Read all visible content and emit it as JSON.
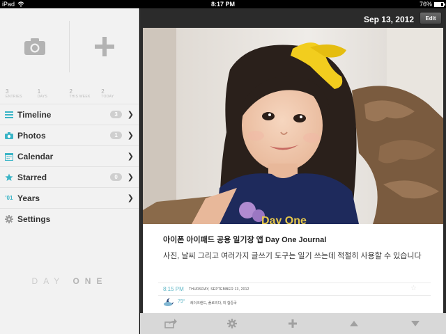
{
  "status": {
    "device": "iPad",
    "time": "8:17 PM",
    "battery": "76%",
    "battery_fraction": 0.76
  },
  "stats": [
    {
      "value": "3",
      "label": "ENTRIES"
    },
    {
      "value": "1",
      "label": "DAYS"
    },
    {
      "value": "2",
      "label": "THIS WEEK"
    },
    {
      "value": "2",
      "label": "TODAY"
    }
  ],
  "nav": [
    {
      "label": "Timeline",
      "badge": "3",
      "icon": "list-icon"
    },
    {
      "label": "Photos",
      "badge": "1",
      "icon": "camera-icon"
    },
    {
      "label": "Calendar",
      "badge": "",
      "icon": "calendar-icon"
    },
    {
      "label": "Starred",
      "badge": "0",
      "icon": "star-icon"
    },
    {
      "label": "Years",
      "badge": "",
      "icon": "years-icon",
      "icon_text": "'01"
    },
    {
      "label": "Settings",
      "badge": "",
      "icon": "gear-icon"
    }
  ],
  "brand": {
    "part1": "DAY",
    "part2": "ONE"
  },
  "header": {
    "date": "Sep 13, 2012",
    "edit_label": "Edit"
  },
  "entry": {
    "title": "아이폰 아이패드 공용 일기장 앱 Day One Journal",
    "body": "사진, 날씨 그리고 여러가지 글쓰기 도구는 일기 쓰는데 적절히 사용할 수 있습니다",
    "time": "8:15 PM",
    "date_long": "THURSDAY, SEPTEMBER 13, 2012",
    "temperature": "79°",
    "location": "레이크랜드, 플로리다, 미 합중국"
  },
  "colors": {
    "accent": "#3ab4c6",
    "sidebar_bg": "#f2f2f2",
    "main_bg": "#2b2b2b"
  }
}
